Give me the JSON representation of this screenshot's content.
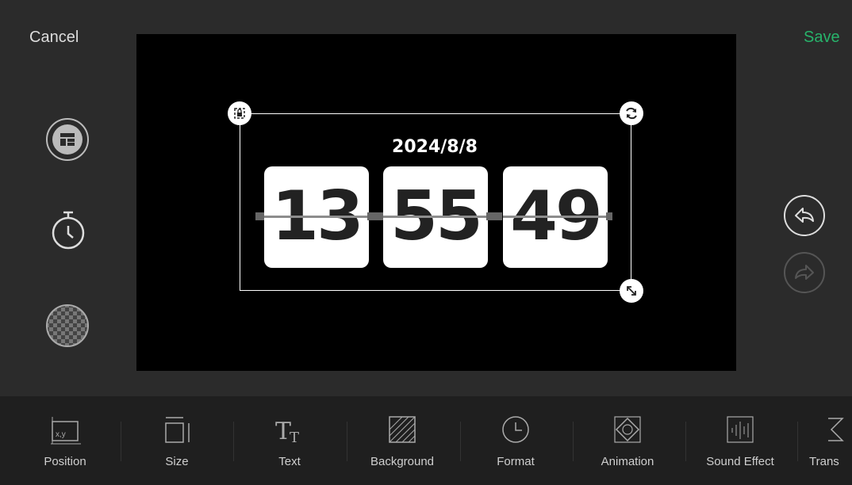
{
  "header": {
    "cancel_label": "Cancel",
    "save_label": "Save"
  },
  "clock": {
    "date": "2024/8/8",
    "hours": "13",
    "minutes": "55",
    "seconds": "49"
  },
  "side_icons": [
    "template-icon",
    "timer-icon",
    "transparency-icon"
  ],
  "history": {
    "undo_icon": "undo-icon",
    "redo_icon": "redo-icon"
  },
  "toolbar": {
    "items": [
      {
        "label": "Position",
        "icon": "position-icon"
      },
      {
        "label": "Size",
        "icon": "size-icon"
      },
      {
        "label": "Text",
        "icon": "text-icon"
      },
      {
        "label": "Background",
        "icon": "background-icon"
      },
      {
        "label": "Format",
        "icon": "format-icon"
      },
      {
        "label": "Animation",
        "icon": "animation-icon"
      },
      {
        "label": "Sound Effect",
        "icon": "sound-effect-icon"
      },
      {
        "label": "Trans",
        "icon": "transition-icon"
      }
    ]
  },
  "colors": {
    "accent": "#27b36b",
    "background": "#2b2b2b",
    "toolbar": "#1f1f1f"
  }
}
